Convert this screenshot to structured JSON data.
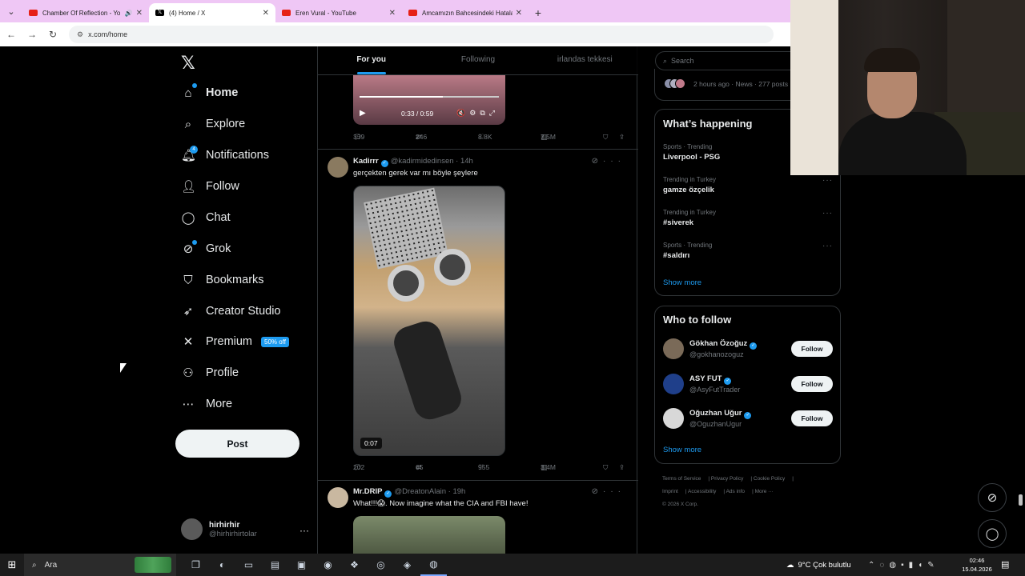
{
  "browser": {
    "tabs": [
      {
        "title": "Chamber Of Reflection - Yo",
        "icon": "youtube-icon",
        "active": false
      },
      {
        "title": "(4) Home / X",
        "icon": "x-icon",
        "active": true
      },
      {
        "title": "Eren Vural - YouTube",
        "icon": "youtube-icon",
        "active": false
      },
      {
        "title": "Amcamızın Bahcesindeki Hatala",
        "icon": "youtube-icon",
        "active": false
      }
    ],
    "url": "x.com/home"
  },
  "sidebar": {
    "items": [
      {
        "label": "Home",
        "icon": "home-icon"
      },
      {
        "label": "Explore",
        "icon": "search-icon"
      },
      {
        "label": "Notifications",
        "icon": "bell-icon",
        "badge": "4"
      },
      {
        "label": "Follow",
        "icon": "add-person-icon"
      },
      {
        "label": "Chat",
        "icon": "chat-icon"
      },
      {
        "label": "Grok",
        "icon": "grok-icon"
      },
      {
        "label": "Bookmarks",
        "icon": "bookmark-icon"
      },
      {
        "label": "Creator Studio",
        "icon": "rocket-icon"
      },
      {
        "label": "Premium",
        "icon": "x-icon",
        "badge": "50% off"
      },
      {
        "label": "Profile",
        "icon": "person-icon"
      },
      {
        "label": "More",
        "icon": "more-circle-icon"
      }
    ],
    "post_label": "Post",
    "account": {
      "name": "hirhirhir",
      "handle": "@hirhirhirtolar"
    }
  },
  "timeline": {
    "tabs": [
      "For you",
      "Following",
      "irlandas tekkesi"
    ],
    "video1": {
      "time": "0:33 / 0:59"
    },
    "post0_stats": {
      "replies": "339",
      "reposts": "246",
      "likes": "8.8K",
      "views": "7.5M"
    },
    "post1": {
      "name": "Kadirrr",
      "handle": "@kadirmidedinsen",
      "time": "· 14h",
      "text": "gerçekten gerek var mı böyle şeylere",
      "duration": "0:07",
      "stats": {
        "replies": "202",
        "reposts": "65",
        "likes": "955",
        "views": "3.4M"
      }
    },
    "post2": {
      "name": "Mr.DRIP",
      "handle": "@DreatonAlain",
      "time": "· 19h",
      "text": "What!!!😱. Now imagine what the CIA and FBI have!"
    }
  },
  "right": {
    "search_placeholder": "Search",
    "news_meta": "2 hours ago · News · 277 posts",
    "happening": {
      "title": "What’s happening",
      "trends": [
        {
          "category": "Sports · Trending",
          "name": "Liverpool - PSG"
        },
        {
          "category": "Trending in Turkey",
          "name": "gamze özçelik"
        },
        {
          "category": "Trending in Turkey",
          "name": "#siverek"
        },
        {
          "category": "Sports · Trending",
          "name": "#saldırı"
        }
      ],
      "show_more": "Show more"
    },
    "who_to_follow": {
      "title": "Who to follow",
      "users": [
        {
          "name": "Gökhan Özoğuz",
          "handle": "@gokhanozoguz",
          "button": "Follow"
        },
        {
          "name": "ASY FUT",
          "handle": "@AsyFutTrader",
          "button": "Follow"
        },
        {
          "name": "Oğuzhan Uğur",
          "handle": "@OguzhanUgur",
          "button": "Follow"
        }
      ],
      "show_more": "Show more"
    },
    "footer": {
      "links": [
        "Terms of Service",
        "Privacy Policy",
        "Cookie Policy",
        "Imprint",
        "Accessibility",
        "Ads info",
        "More ···"
      ],
      "copyright": "© 2026 X Corp."
    }
  },
  "taskbar": {
    "search": "Ara",
    "weather": "9°C  Çok bulutlu",
    "time": "02:46",
    "date": "15.04.2026"
  },
  "colors": {
    "accent": "#1d9bf0",
    "background": "#000000",
    "tabbar": "#efc7f5"
  }
}
